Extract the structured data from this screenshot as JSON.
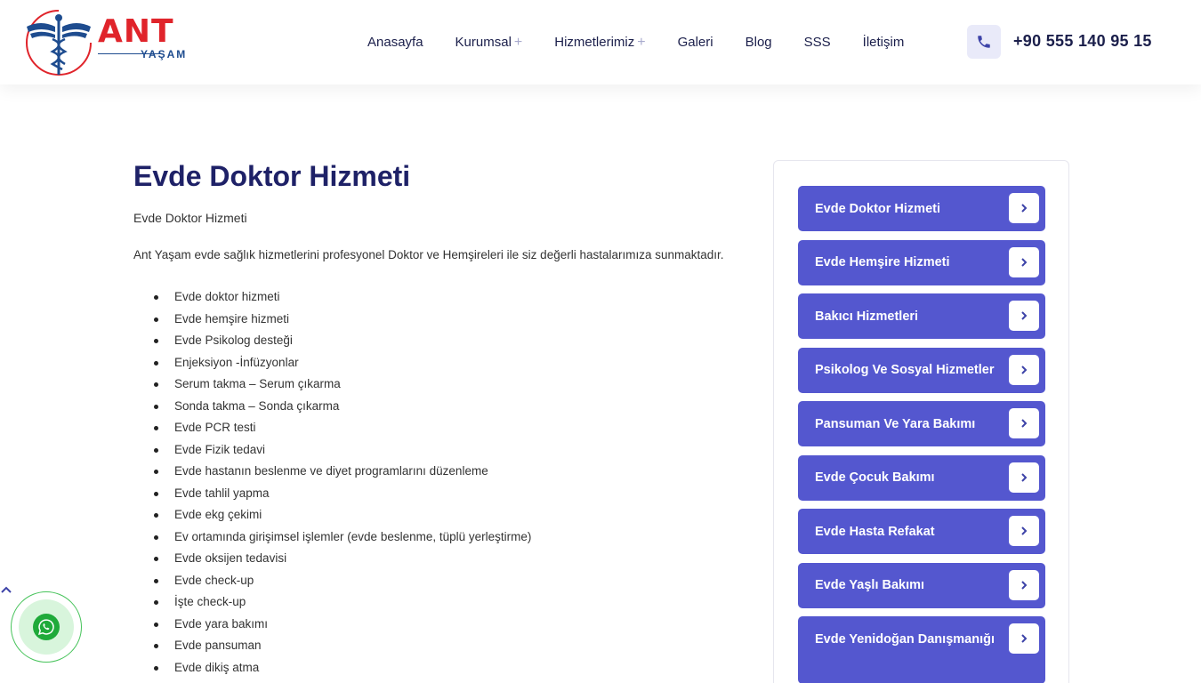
{
  "brand": {
    "name": "ANT",
    "sub": "YAŞAM"
  },
  "nav": {
    "items": [
      {
        "label": "Anasayfa",
        "has_submenu": false
      },
      {
        "label": "Kurumsal",
        "has_submenu": true
      },
      {
        "label": "Hizmetlerimiz",
        "has_submenu": true
      },
      {
        "label": "Galeri",
        "has_submenu": false
      },
      {
        "label": "Blog",
        "has_submenu": false
      },
      {
        "label": "SSS",
        "has_submenu": false
      },
      {
        "label": "İletişim",
        "has_submenu": false
      }
    ],
    "submenu_symbol": "+",
    "phone_icon": "phone-icon",
    "phone": "+90 555 140 95 15"
  },
  "content": {
    "title": "Evde Doktor Hizmeti",
    "subtitle": "Evde Doktor Hizmeti",
    "intro": "Ant Yaşam evde sağlık hizmetlerini profesyonel Doktor ve Hemşireleri ile siz değerli hastalarımıza sunmaktadır.",
    "services": [
      "Evde doktor hizmeti",
      "Evde hemşire hizmeti",
      "Evde Psikolog desteği",
      "Enjeksiyon -İnfüzyonlar",
      "Serum takma – Serum çıkarma",
      "Sonda takma – Sonda çıkarma",
      "Evde PCR testi",
      "Evde Fizik tedavi",
      "Evde hastanın beslenme ve diyet programlarını düzenleme",
      "Evde tahlil yapma",
      "Evde ekg çekimi",
      "Ev ortamında girişimsel işlemler (evde beslenme, tüplü yerleştirme)",
      "Evde oksijen tedavisi",
      "Evde check-up",
      "İşte check-up",
      "Evde yara bakımı",
      "Evde pansuman",
      "Evde dikiş atma"
    ]
  },
  "sidebar": {
    "items": [
      "Evde Doktor Hizmeti",
      "Evde Hemşire Hizmeti",
      "Bakıcı Hizmetleri",
      "Psikolog Ve Sosyal Hizmetler",
      "Pansuman Ve Yara Bakımı",
      "Evde Çocuk Bakımı",
      "Evde Hasta Refakat",
      "Evde Yaşlı Bakımı",
      "Evde Yenidoğan Danışmanığı"
    ],
    "arrow_icon": "chevron-right-icon"
  },
  "floating": {
    "scroll_icon": "chevron-up-icon",
    "whatsapp_icon": "whatsapp-icon"
  },
  "colors": {
    "primary": "#5457cf",
    "heading": "#1e2167",
    "brand_red": "#e0242b",
    "brand_blue": "#1e4c8f",
    "whatsapp": "#1faa3a"
  }
}
